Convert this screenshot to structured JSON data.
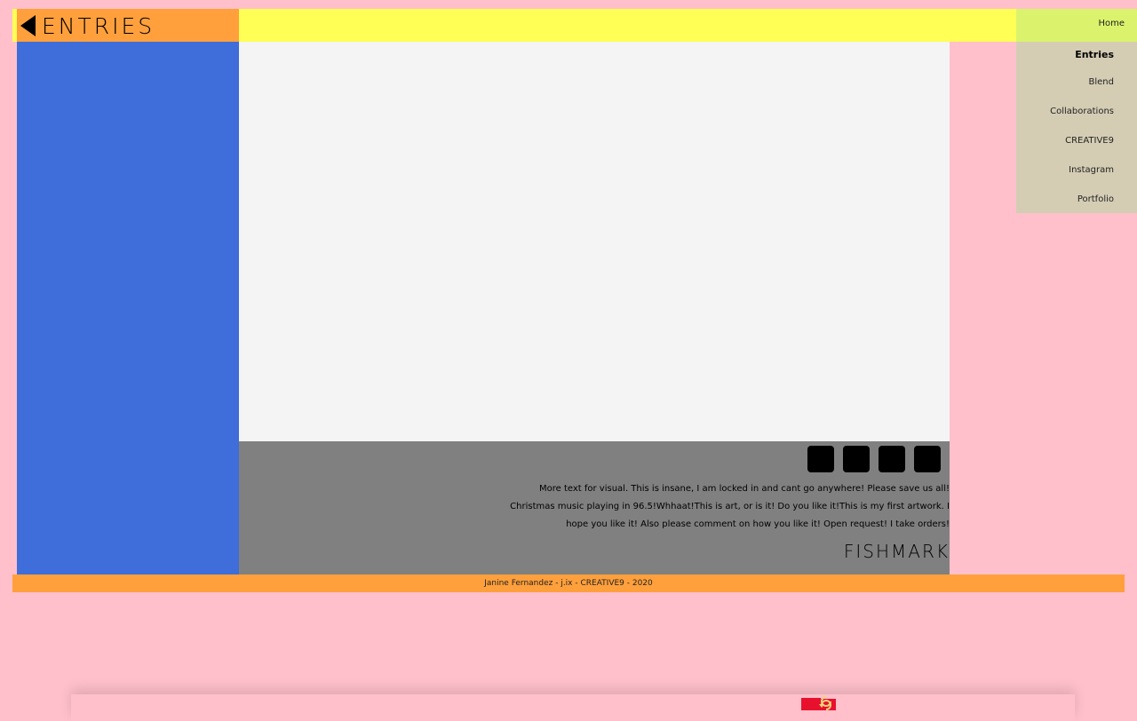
{
  "header": {
    "title": "ENTRIES"
  },
  "nav": {
    "items": [
      {
        "label": "Home"
      },
      {
        "label": "Entries"
      },
      {
        "label": "Blend"
      },
      {
        "label": "Collaborations"
      },
      {
        "label": "CREATIVE9"
      },
      {
        "label": "Instagram"
      },
      {
        "label": "Portfolio"
      }
    ],
    "active": "Entries"
  },
  "artwork": {
    "description": "More text for visual. This is insane, I am locked in and cant go anywhere! Please save us all! Christmas music playing in 96.5!Whhaat!This is art, or is it! Do you like it!This is my first artwork. I hope you like it! Also please comment on how you like it! Open request! I take orders!",
    "name": "FISHMARK"
  },
  "footer": {
    "text": "Janine Fernandez - j.ix - CREATIVE9 - 2020"
  },
  "colors": {
    "background": "#ffc0cb",
    "header": "#ffff55",
    "title_block": "#ffa03c",
    "sidebar": "#3f6dd9",
    "canvas": "#f4f4f4",
    "info_panel": "#808080",
    "nav_menu": "#d4cdb4",
    "nav_home": "#dbf36c",
    "footer": "#ffa03c"
  },
  "icons": {
    "back": "triangle-left-icon",
    "action_buttons": [
      "square-icon",
      "square-icon",
      "square-icon",
      "square-icon"
    ]
  }
}
